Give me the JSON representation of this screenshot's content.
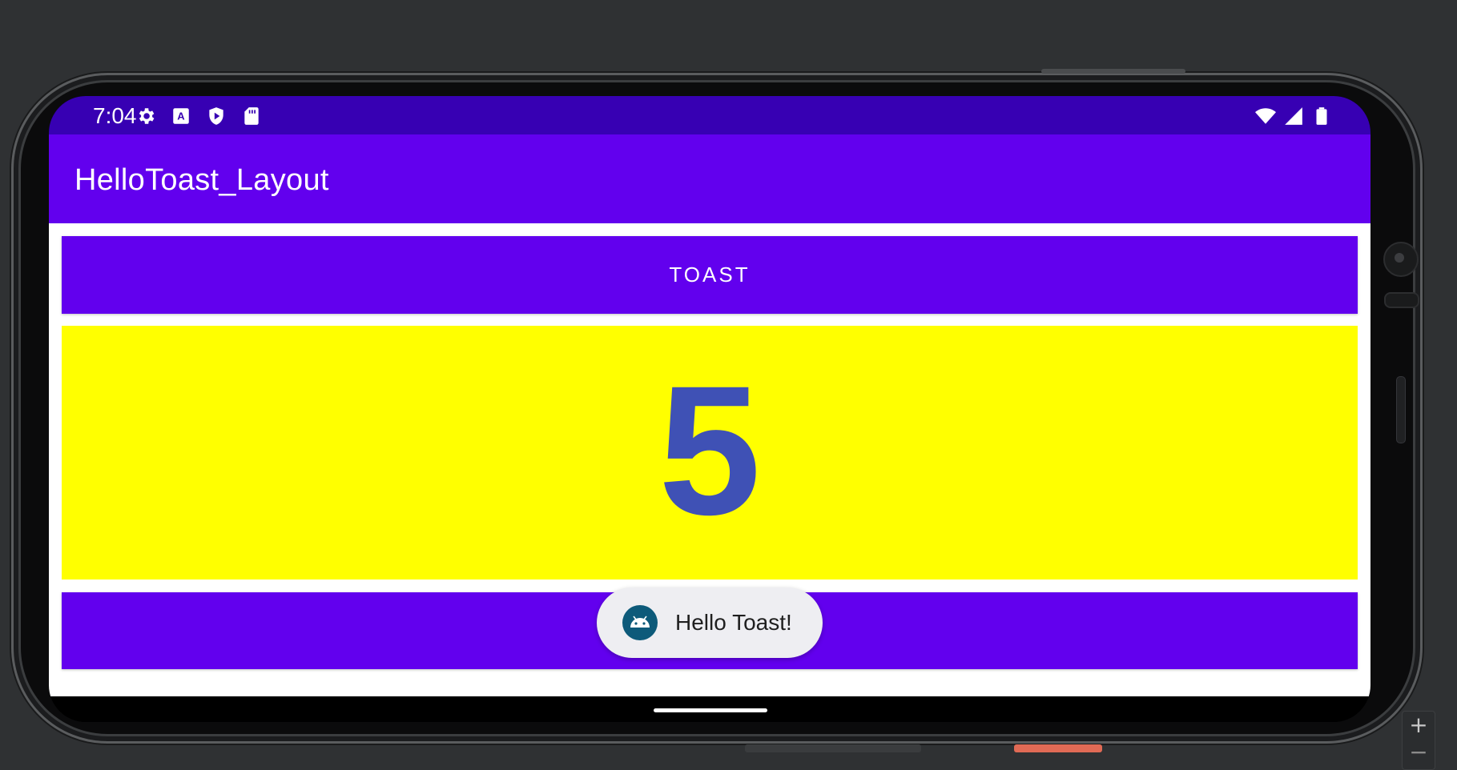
{
  "status_bar": {
    "time": "7:04",
    "left_icons": [
      "settings-gear-icon",
      "keyboard-a-icon",
      "play-protect-shield-icon",
      "sd-card-icon"
    ],
    "right_icons": [
      "wifi-icon",
      "cellular-signal-icon",
      "battery-icon"
    ]
  },
  "app_bar": {
    "title": "HelloToast_Layout"
  },
  "main": {
    "toast_button_label": "TOAST",
    "count_value": "5",
    "count_background": "#ffff00",
    "count_text_color": "#3f51b5"
  },
  "toast": {
    "message": "Hello Toast!",
    "icon": "android-app-icon"
  },
  "colors": {
    "status_bar": "#3700b3",
    "primary": "#6200ee"
  },
  "emulator": {
    "zoom_in_label": "+",
    "zoom_out_label": "−"
  }
}
